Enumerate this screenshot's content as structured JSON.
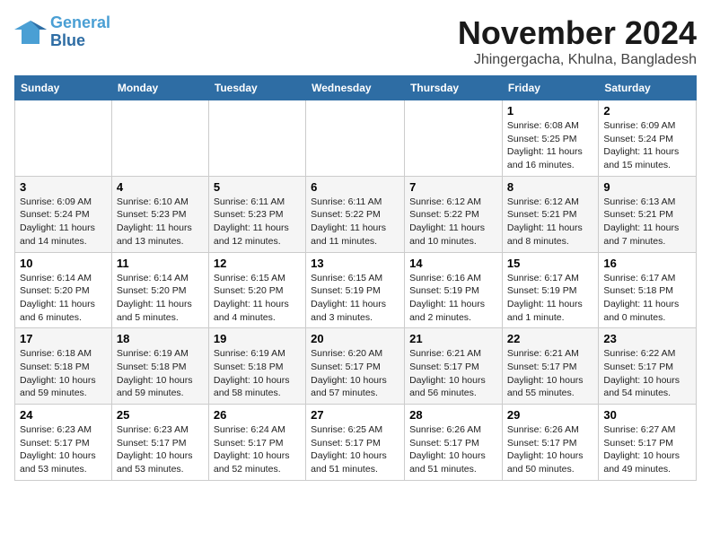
{
  "logo": {
    "line1": "General",
    "line2": "Blue"
  },
  "title": "November 2024",
  "location": "Jhingergacha, Khulna, Bangladesh",
  "weekdays": [
    "Sunday",
    "Monday",
    "Tuesday",
    "Wednesday",
    "Thursday",
    "Friday",
    "Saturday"
  ],
  "weeks": [
    [
      {
        "day": "",
        "detail": ""
      },
      {
        "day": "",
        "detail": ""
      },
      {
        "day": "",
        "detail": ""
      },
      {
        "day": "",
        "detail": ""
      },
      {
        "day": "",
        "detail": ""
      },
      {
        "day": "1",
        "detail": "Sunrise: 6:08 AM\nSunset: 5:25 PM\nDaylight: 11 hours and 16 minutes."
      },
      {
        "day": "2",
        "detail": "Sunrise: 6:09 AM\nSunset: 5:24 PM\nDaylight: 11 hours and 15 minutes."
      }
    ],
    [
      {
        "day": "3",
        "detail": "Sunrise: 6:09 AM\nSunset: 5:24 PM\nDaylight: 11 hours and 14 minutes."
      },
      {
        "day": "4",
        "detail": "Sunrise: 6:10 AM\nSunset: 5:23 PM\nDaylight: 11 hours and 13 minutes."
      },
      {
        "day": "5",
        "detail": "Sunrise: 6:11 AM\nSunset: 5:23 PM\nDaylight: 11 hours and 12 minutes."
      },
      {
        "day": "6",
        "detail": "Sunrise: 6:11 AM\nSunset: 5:22 PM\nDaylight: 11 hours and 11 minutes."
      },
      {
        "day": "7",
        "detail": "Sunrise: 6:12 AM\nSunset: 5:22 PM\nDaylight: 11 hours and 10 minutes."
      },
      {
        "day": "8",
        "detail": "Sunrise: 6:12 AM\nSunset: 5:21 PM\nDaylight: 11 hours and 8 minutes."
      },
      {
        "day": "9",
        "detail": "Sunrise: 6:13 AM\nSunset: 5:21 PM\nDaylight: 11 hours and 7 minutes."
      }
    ],
    [
      {
        "day": "10",
        "detail": "Sunrise: 6:14 AM\nSunset: 5:20 PM\nDaylight: 11 hours and 6 minutes."
      },
      {
        "day": "11",
        "detail": "Sunrise: 6:14 AM\nSunset: 5:20 PM\nDaylight: 11 hours and 5 minutes."
      },
      {
        "day": "12",
        "detail": "Sunrise: 6:15 AM\nSunset: 5:20 PM\nDaylight: 11 hours and 4 minutes."
      },
      {
        "day": "13",
        "detail": "Sunrise: 6:15 AM\nSunset: 5:19 PM\nDaylight: 11 hours and 3 minutes."
      },
      {
        "day": "14",
        "detail": "Sunrise: 6:16 AM\nSunset: 5:19 PM\nDaylight: 11 hours and 2 minutes."
      },
      {
        "day": "15",
        "detail": "Sunrise: 6:17 AM\nSunset: 5:19 PM\nDaylight: 11 hours and 1 minute."
      },
      {
        "day": "16",
        "detail": "Sunrise: 6:17 AM\nSunset: 5:18 PM\nDaylight: 11 hours and 0 minutes."
      }
    ],
    [
      {
        "day": "17",
        "detail": "Sunrise: 6:18 AM\nSunset: 5:18 PM\nDaylight: 10 hours and 59 minutes."
      },
      {
        "day": "18",
        "detail": "Sunrise: 6:19 AM\nSunset: 5:18 PM\nDaylight: 10 hours and 59 minutes."
      },
      {
        "day": "19",
        "detail": "Sunrise: 6:19 AM\nSunset: 5:18 PM\nDaylight: 10 hours and 58 minutes."
      },
      {
        "day": "20",
        "detail": "Sunrise: 6:20 AM\nSunset: 5:17 PM\nDaylight: 10 hours and 57 minutes."
      },
      {
        "day": "21",
        "detail": "Sunrise: 6:21 AM\nSunset: 5:17 PM\nDaylight: 10 hours and 56 minutes."
      },
      {
        "day": "22",
        "detail": "Sunrise: 6:21 AM\nSunset: 5:17 PM\nDaylight: 10 hours and 55 minutes."
      },
      {
        "day": "23",
        "detail": "Sunrise: 6:22 AM\nSunset: 5:17 PM\nDaylight: 10 hours and 54 minutes."
      }
    ],
    [
      {
        "day": "24",
        "detail": "Sunrise: 6:23 AM\nSunset: 5:17 PM\nDaylight: 10 hours and 53 minutes."
      },
      {
        "day": "25",
        "detail": "Sunrise: 6:23 AM\nSunset: 5:17 PM\nDaylight: 10 hours and 53 minutes."
      },
      {
        "day": "26",
        "detail": "Sunrise: 6:24 AM\nSunset: 5:17 PM\nDaylight: 10 hours and 52 minutes."
      },
      {
        "day": "27",
        "detail": "Sunrise: 6:25 AM\nSunset: 5:17 PM\nDaylight: 10 hours and 51 minutes."
      },
      {
        "day": "28",
        "detail": "Sunrise: 6:26 AM\nSunset: 5:17 PM\nDaylight: 10 hours and 51 minutes."
      },
      {
        "day": "29",
        "detail": "Sunrise: 6:26 AM\nSunset: 5:17 PM\nDaylight: 10 hours and 50 minutes."
      },
      {
        "day": "30",
        "detail": "Sunrise: 6:27 AM\nSunset: 5:17 PM\nDaylight: 10 hours and 49 minutes."
      }
    ]
  ]
}
